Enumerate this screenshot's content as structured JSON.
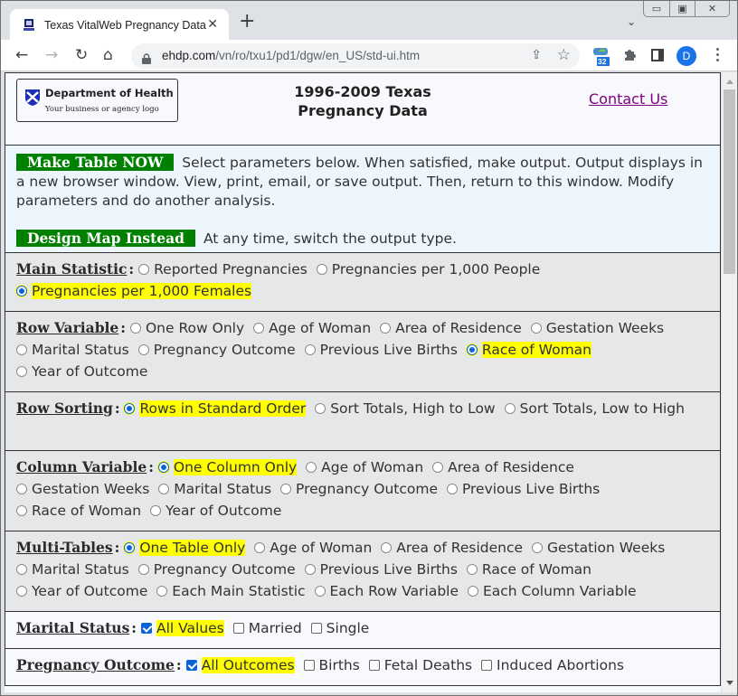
{
  "browser": {
    "tab_title": "Texas VitalWeb Pregnancy Data - ",
    "url_host": "ehdp.com",
    "url_path": "/vn/ro/txu1/pd1/dgw/en_US/std-ui.htm",
    "extension_badge": "32",
    "profile_initial": "D",
    "window_controls": [
      "minimize",
      "restore",
      "close"
    ]
  },
  "header": {
    "logo_title": "Department of Health",
    "logo_subtitle": "Your business or agency logo",
    "page_title_line1": "1996-2009 Texas",
    "page_title_line2": "Pregnancy Data",
    "contact_link": "Contact Us"
  },
  "intro": {
    "make_table_button": "Make Table NOW",
    "make_table_text": "Select parameters below. When satisfied, make output. Output displays in a new browser window. View, print, email, or save output. Then, return to this window. Modify parameters and do another analysis.",
    "design_map_button": "Design Map Instead",
    "design_map_text": "At any time, switch the output type."
  },
  "sections": {
    "main_statistic": {
      "label": "Main Statistic",
      "options": [
        "Reported Pregnancies",
        "Pregnancies per 1,000 People",
        "Pregnancies per 1,000 Females"
      ],
      "selected": "Pregnancies per 1,000 Females"
    },
    "row_variable": {
      "label": "Row Variable",
      "options": [
        "One Row Only",
        "Age of Woman",
        "Area of Residence",
        "Gestation Weeks",
        "Marital Status",
        "Pregnancy Outcome",
        "Previous Live Births",
        "Race of Woman",
        "Year of Outcome"
      ],
      "selected": "Race of Woman"
    },
    "row_sorting": {
      "label": "Row Sorting",
      "options": [
        "Rows in Standard Order",
        "Sort Totals, High to Low",
        "Sort Totals, Low to High"
      ],
      "selected": "Rows in Standard Order"
    },
    "column_variable": {
      "label": "Column Variable",
      "options": [
        "One Column Only",
        "Age of Woman",
        "Area of Residence",
        "Gestation Weeks",
        "Marital Status",
        "Pregnancy Outcome",
        "Previous Live Births",
        "Race of Woman",
        "Year of Outcome"
      ],
      "selected": "One Column Only"
    },
    "multi_tables": {
      "label": "Multi-Tables",
      "options": [
        "One Table Only",
        "Age of Woman",
        "Area of Residence",
        "Gestation Weeks",
        "Marital Status",
        "Pregnancy Outcome",
        "Previous Live Births",
        "Race of Woman",
        "Year of Outcome",
        "Each Main Statistic",
        "Each Row Variable",
        "Each Column Variable"
      ],
      "selected": "One Table Only"
    },
    "marital_status": {
      "label": "Marital Status",
      "options": [
        "All Values",
        "Married",
        "Single"
      ],
      "checked": [
        "All Values"
      ]
    },
    "pregnancy_outcome": {
      "label": "Pregnancy Outcome",
      "options": [
        "All Outcomes",
        "Births",
        "Fetal Deaths",
        "Induced Abortions"
      ],
      "checked": [
        "All Outcomes"
      ]
    }
  }
}
